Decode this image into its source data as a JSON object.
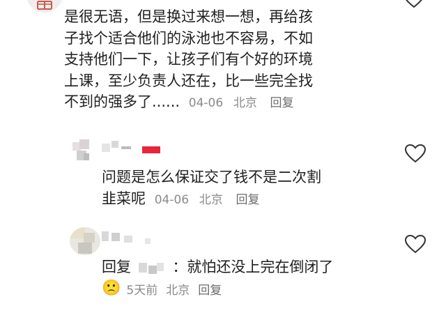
{
  "comments": [
    {
      "lines": [
        "是很无语，但是换过来想一想，再给孩",
        "子找个适合他们的泳池也不容易，不如",
        "支持他们一下，让孩子们有个好的环境",
        "上课，至少负责人还在，比一些完全找",
        "不到的强多了......"
      ],
      "date": "04-06",
      "location": "北京",
      "reply_label": "回复"
    },
    {
      "lines": [
        "问题是怎么保证交了钱不是二次割",
        "韭菜呢"
      ],
      "date": "04-06",
      "location": "北京",
      "reply_label": "回复"
    },
    {
      "prefix": "回复",
      "text": "：就怕还没上完在倒闭了",
      "emoji": "🙁",
      "date": "5天前",
      "location": "北京",
      "reply_label": "回复"
    }
  ],
  "icons": {
    "like": "heart-outline-icon",
    "gift": "gift-icon",
    "emoji": "frowning-face-icon"
  },
  "colors": {
    "meta": "#8a8a8a",
    "reply": "#6b6b6b",
    "badge": "#e8253a"
  }
}
